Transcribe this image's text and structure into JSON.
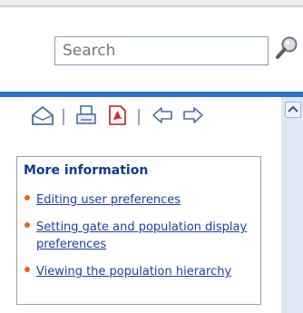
{
  "search": {
    "placeholder": "Search",
    "value": ""
  },
  "toolbar": {
    "icons": [
      "home-icon",
      "print-icon",
      "pdf-icon",
      "back-arrow-icon",
      "forward-arrow-icon"
    ]
  },
  "more_info": {
    "title": "More information",
    "links": [
      "Editing user preferences",
      "Setting gate and population display preferences",
      "Viewing the population hierarchy"
    ]
  },
  "colors": {
    "accent_bar": "#2e71c8",
    "link": "#1d3fa8",
    "title": "#0b3d91",
    "bullet": "#e2671b"
  }
}
